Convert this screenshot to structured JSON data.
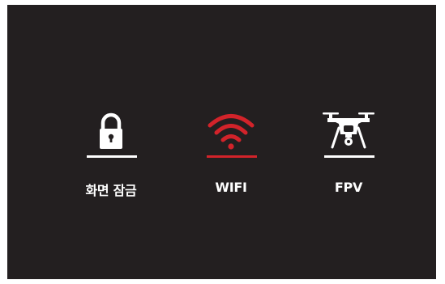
{
  "menu": {
    "items": [
      {
        "label": "화면 잠금",
        "icon": "lock-icon",
        "selected": false
      },
      {
        "label": "WIFI",
        "icon": "wifi-icon",
        "selected": true
      },
      {
        "label": "FPV",
        "icon": "drone-icon",
        "selected": false
      }
    ]
  },
  "colors": {
    "background": "#231f20",
    "default": "#ffffff",
    "selected": "#d2232a"
  }
}
